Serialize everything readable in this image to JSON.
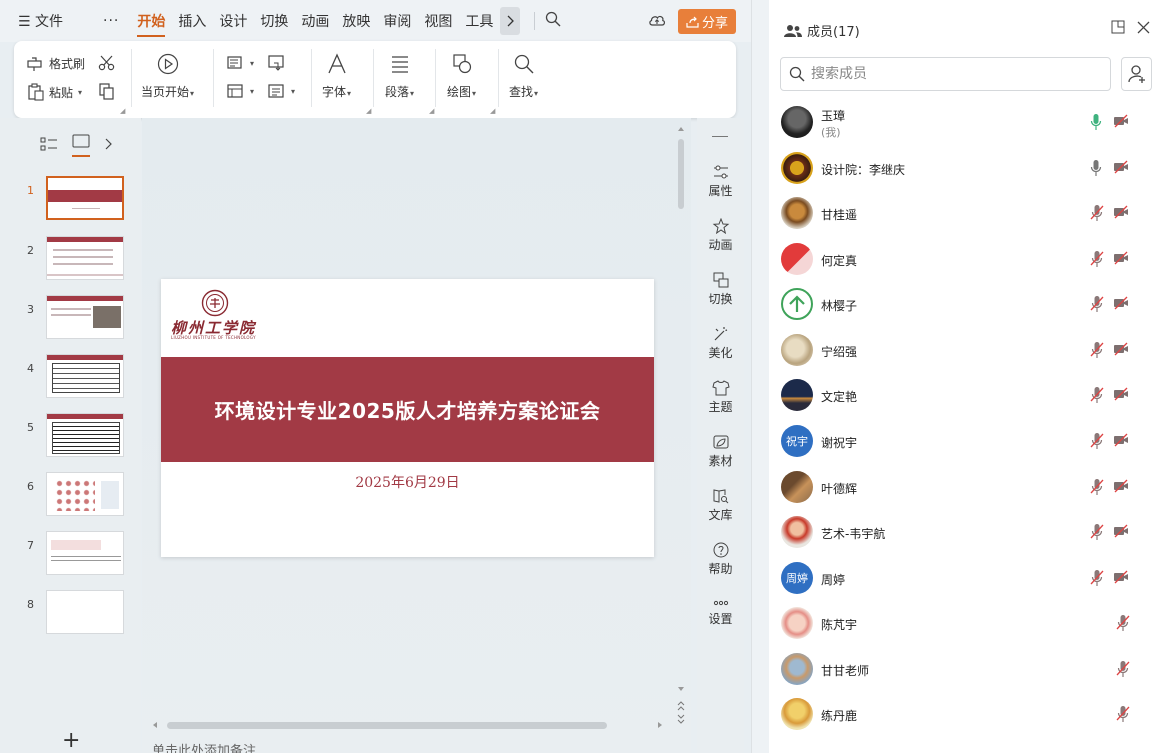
{
  "menubar": {
    "menu_label": "文件",
    "more": "···",
    "tabs": [
      "开始",
      "插入",
      "设计",
      "切换",
      "动画",
      "放映",
      "审阅",
      "视图",
      "工具"
    ],
    "active_tab": "开始",
    "share": "分享"
  },
  "ribbon": {
    "format_painter": "格式刷",
    "paste": "粘贴",
    "play_current": "当页开始",
    "font": "字体",
    "paragraph": "段落",
    "drawing": "绘图",
    "find": "查找"
  },
  "slides": [
    "1",
    "2",
    "3",
    "4",
    "5",
    "6",
    "7",
    "8"
  ],
  "selected_slide": "1",
  "slide": {
    "school_cn": "柳州工学院",
    "school_en": "LIUZHOU INSTITUTE OF TECHNOLOGY",
    "title": "环境设计专业2025版人才培养方案论证会",
    "date": "2025年6月29日"
  },
  "notes_placeholder": "单击此处添加备注",
  "tools": [
    "属性",
    "动画",
    "切换",
    "美化",
    "主题",
    "素材",
    "文库",
    "帮助",
    "设置"
  ],
  "members": {
    "title": "成员(17)",
    "search_placeholder": "搜索成员",
    "list": [
      {
        "name": "玉璋",
        "sub": "(我)",
        "mic": "on",
        "cam": "off"
      },
      {
        "name": "设计院：李继庆",
        "mic": "idle",
        "cam": "off"
      },
      {
        "name": "甘桂遥",
        "mic": "muted",
        "cam": "off"
      },
      {
        "name": "何定真",
        "mic": "muted",
        "cam": "off"
      },
      {
        "name": "林樱子",
        "mic": "muted",
        "cam": "off"
      },
      {
        "name": "宁绍强",
        "mic": "muted",
        "cam": "off"
      },
      {
        "name": "文定艳",
        "mic": "muted",
        "cam": "off"
      },
      {
        "name": "谢祝宇",
        "avatar_text": "祝宇",
        "mic": "muted",
        "cam": "off"
      },
      {
        "name": "叶德辉",
        "mic": "muted",
        "cam": "off"
      },
      {
        "name": "艺术-韦宇航",
        "mic": "muted",
        "cam": "off"
      },
      {
        "name": "周婷",
        "avatar_text": "周婷",
        "mic": "muted",
        "cam": "off"
      },
      {
        "name": "陈芃宇",
        "mic": "muted"
      },
      {
        "name": "甘甘老师",
        "mic": "muted"
      },
      {
        "name": "练丹鹿",
        "mic": "muted"
      }
    ]
  },
  "colors": {
    "accent": "#d1611e",
    "share_button": "#e87f3a",
    "slide_band": "#a23a45",
    "mic_on": "#3fb27f",
    "avatar_blue": "#2f6fc2"
  }
}
